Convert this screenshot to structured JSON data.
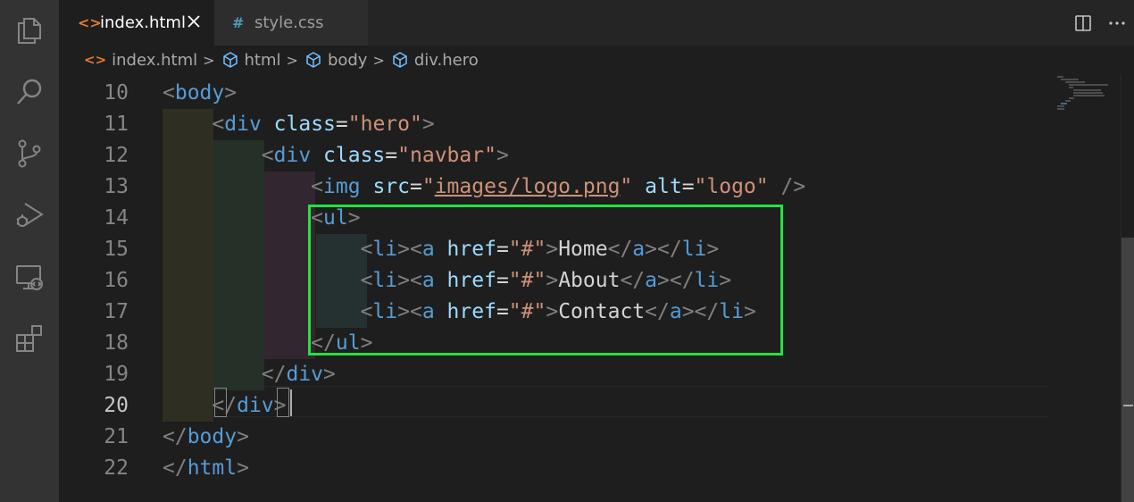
{
  "tabs": [
    {
      "icon": "<>",
      "label": "index.html",
      "active": true
    },
    {
      "icon": "#",
      "label": "style.css",
      "active": false
    }
  ],
  "breadcrumb": [
    {
      "icon": "html-file-icon",
      "label": "index.html"
    },
    {
      "icon": "cube-icon",
      "label": "html"
    },
    {
      "icon": "cube-icon",
      "label": "body"
    },
    {
      "icon": "cube-icon",
      "label": "div.hero"
    }
  ],
  "breadcrumb_separator": ">",
  "lines": [
    {
      "number": "10",
      "tokens": [
        [
          "punc",
          "<"
        ],
        [
          "tag",
          "body"
        ],
        [
          "punc",
          ">"
        ]
      ]
    },
    {
      "number": "11",
      "tokens": [
        [
          "ws",
          "    "
        ],
        [
          "punc",
          "<"
        ],
        [
          "tag",
          "div"
        ],
        [
          "ws",
          " "
        ],
        [
          "attr",
          "class"
        ],
        [
          "eq",
          "="
        ],
        [
          "str",
          "\"hero\""
        ],
        [
          "punc",
          ">"
        ]
      ]
    },
    {
      "number": "12",
      "tokens": [
        [
          "ws",
          "        "
        ],
        [
          "punc",
          "<"
        ],
        [
          "tag",
          "div"
        ],
        [
          "ws",
          " "
        ],
        [
          "attr",
          "class"
        ],
        [
          "eq",
          "="
        ],
        [
          "str",
          "\"navbar\""
        ],
        [
          "punc",
          ">"
        ]
      ]
    },
    {
      "number": "13",
      "tokens": [
        [
          "ws",
          "            "
        ],
        [
          "punc",
          "<"
        ],
        [
          "tag",
          "img"
        ],
        [
          "ws",
          " "
        ],
        [
          "attr",
          "src"
        ],
        [
          "eq",
          "="
        ],
        [
          "str",
          "\""
        ],
        [
          "link",
          "images/logo.png"
        ],
        [
          "str",
          "\""
        ],
        [
          "ws",
          " "
        ],
        [
          "attr",
          "alt"
        ],
        [
          "eq",
          "="
        ],
        [
          "str",
          "\"logo\""
        ],
        [
          "ws",
          " "
        ],
        [
          "punc",
          "/>"
        ]
      ]
    },
    {
      "number": "14",
      "tokens": [
        [
          "ws",
          "            "
        ],
        [
          "punc",
          "<"
        ],
        [
          "tag",
          "ul"
        ],
        [
          "punc",
          ">"
        ]
      ]
    },
    {
      "number": "15",
      "tokens": [
        [
          "ws",
          "                "
        ],
        [
          "punc",
          "<"
        ],
        [
          "tag",
          "li"
        ],
        [
          "punc",
          "><"
        ],
        [
          "tag",
          "a"
        ],
        [
          "ws",
          " "
        ],
        [
          "attr",
          "href"
        ],
        [
          "eq",
          "="
        ],
        [
          "str",
          "\"#\""
        ],
        [
          "punc",
          ">"
        ],
        [
          "txt",
          "Home"
        ],
        [
          "punc",
          "</"
        ],
        [
          "tag",
          "a"
        ],
        [
          "punc",
          "></"
        ],
        [
          "tag",
          "li"
        ],
        [
          "punc",
          ">"
        ]
      ]
    },
    {
      "number": "16",
      "tokens": [
        [
          "ws",
          "                "
        ],
        [
          "punc",
          "<"
        ],
        [
          "tag",
          "li"
        ],
        [
          "punc",
          "><"
        ],
        [
          "tag",
          "a"
        ],
        [
          "ws",
          " "
        ],
        [
          "attr",
          "href"
        ],
        [
          "eq",
          "="
        ],
        [
          "str",
          "\"#\""
        ],
        [
          "punc",
          ">"
        ],
        [
          "txt",
          "About"
        ],
        [
          "punc",
          "</"
        ],
        [
          "tag",
          "a"
        ],
        [
          "punc",
          "></"
        ],
        [
          "tag",
          "li"
        ],
        [
          "punc",
          ">"
        ]
      ]
    },
    {
      "number": "17",
      "tokens": [
        [
          "ws",
          "                "
        ],
        [
          "punc",
          "<"
        ],
        [
          "tag",
          "li"
        ],
        [
          "punc",
          "><"
        ],
        [
          "tag",
          "a"
        ],
        [
          "ws",
          " "
        ],
        [
          "attr",
          "href"
        ],
        [
          "eq",
          "="
        ],
        [
          "str",
          "\"#\""
        ],
        [
          "punc",
          ">"
        ],
        [
          "txt",
          "Contact"
        ],
        [
          "punc",
          "</"
        ],
        [
          "tag",
          "a"
        ],
        [
          "punc",
          "></"
        ],
        [
          "tag",
          "li"
        ],
        [
          "punc",
          ">"
        ]
      ]
    },
    {
      "number": "18",
      "tokens": [
        [
          "ws",
          "            "
        ],
        [
          "punc",
          "</"
        ],
        [
          "tag",
          "ul"
        ],
        [
          "punc",
          ">"
        ]
      ]
    },
    {
      "number": "19",
      "tokens": [
        [
          "ws",
          "        "
        ],
        [
          "punc",
          "</"
        ],
        [
          "tag",
          "div"
        ],
        [
          "punc",
          ">"
        ]
      ]
    },
    {
      "number": "20",
      "tokens": [
        [
          "ws",
          "    "
        ],
        [
          "punc",
          "</"
        ],
        [
          "tag",
          "div"
        ],
        [
          "punc",
          ">"
        ]
      ]
    },
    {
      "number": "21",
      "tokens": [
        [
          "punc",
          "</"
        ],
        [
          "tag",
          "body"
        ],
        [
          "punc",
          ">"
        ]
      ]
    },
    {
      "number": "22",
      "tokens": [
        [
          "punc",
          "</"
        ],
        [
          "tag",
          "html"
        ],
        [
          "punc",
          ">"
        ]
      ]
    }
  ],
  "active_line": "20",
  "colors": {
    "highlight_box": "#22e33f",
    "indent_guide_1": "#2e2f22",
    "indent_guide_2": "#253028",
    "indent_guide_3": "#322730",
    "indent_guide_4": "#243130"
  }
}
